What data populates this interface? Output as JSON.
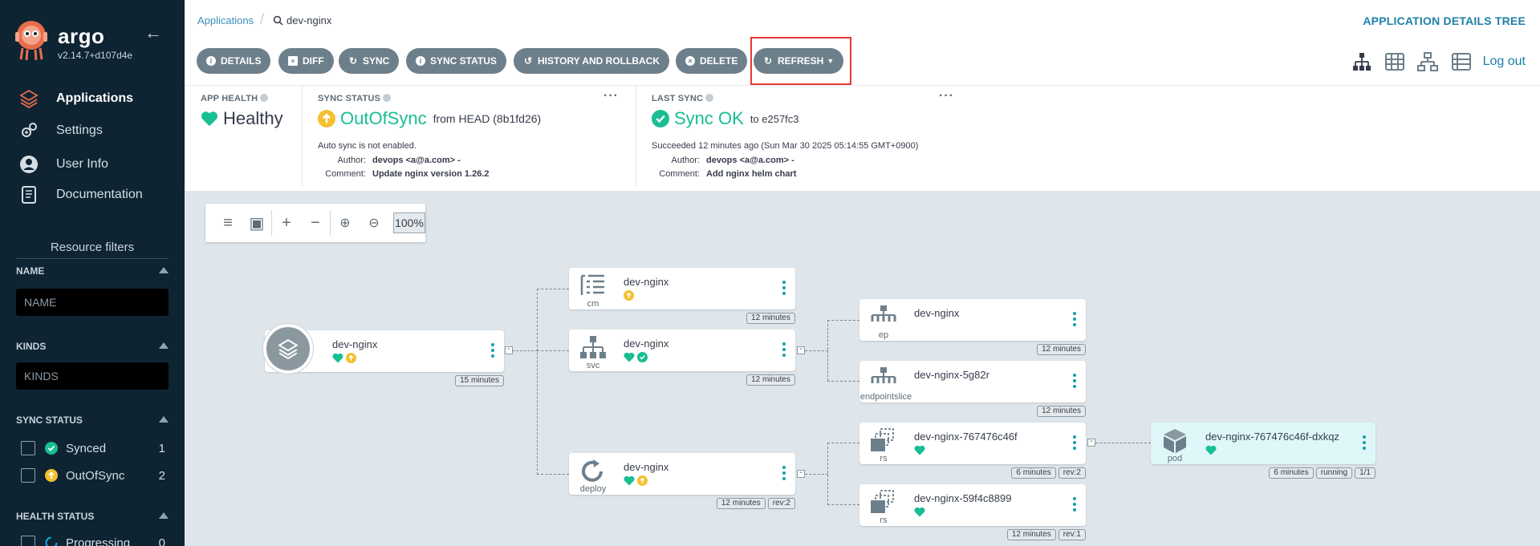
{
  "sidebar": {
    "brand": "argo",
    "version": "v2.14.7+d107d4e",
    "nav": [
      {
        "label": "Applications"
      },
      {
        "label": "Settings"
      },
      {
        "label": "User Info"
      },
      {
        "label": "Documentation"
      }
    ],
    "resource_filters": {
      "title": "Resource filters",
      "name_label": "NAME",
      "name_placeholder": "NAME",
      "kinds_label": "KINDS",
      "kinds_placeholder": "KINDS",
      "sync_label": "SYNC STATUS",
      "sync_items": [
        {
          "label": "Synced",
          "count": "1"
        },
        {
          "label": "OutOfSync",
          "count": "2"
        }
      ],
      "health_label": "HEALTH STATUS",
      "health_items": [
        {
          "label": "Progressing",
          "count": "0"
        }
      ]
    }
  },
  "topbar": {
    "crumb_app": "Applications",
    "crumb_current": "dev-nginx",
    "page_title": "APPLICATION DETAILS TREE"
  },
  "toolbar": {
    "buttons": [
      {
        "label": "DETAILS"
      },
      {
        "label": "DIFF"
      },
      {
        "label": "SYNC"
      },
      {
        "label": "SYNC STATUS"
      },
      {
        "label": "HISTORY AND ROLLBACK"
      },
      {
        "label": "DELETE"
      },
      {
        "label": "REFRESH"
      }
    ],
    "logout": "Log out"
  },
  "status": {
    "app_health": {
      "label": "APP HEALTH",
      "value": "Healthy"
    },
    "sync_status": {
      "label": "SYNC STATUS",
      "value": "OutOfSync",
      "from": "from HEAD (8b1fd26)",
      "auto_sync": "Auto sync is not enabled.",
      "author_key": "Author:",
      "author": "devops <a@a.com> -",
      "comment_key": "Comment:",
      "comment": "Update nginx version 1.26.2"
    },
    "last_sync": {
      "label": "LAST SYNC",
      "value": "Sync OK",
      "to": "to e257fc3",
      "succeeded": "Succeeded 12 minutes ago (Sun Mar 30 2025 05:14:55 GMT+0900)",
      "author_key": "Author:",
      "author": "devops <a@a.com> -",
      "comment_key": "Comment:",
      "comment": "Add nginx helm chart"
    }
  },
  "zoom": {
    "percent": "100%"
  },
  "tree": {
    "app": {
      "name": "dev-nginx",
      "age": "15 minutes"
    },
    "nodes": [
      {
        "id": "cm",
        "name": "dev-nginx",
        "kind": "cm",
        "tags": [
          "12 minutes"
        ]
      },
      {
        "id": "svc",
        "name": "dev-nginx",
        "kind": "svc",
        "tags": [
          "12 minutes"
        ]
      },
      {
        "id": "deploy",
        "name": "dev-nginx",
        "kind": "deploy",
        "tags": [
          "12 minutes",
          "rev:2"
        ]
      },
      {
        "id": "ep",
        "name": "dev-nginx",
        "kind": "ep",
        "tags": [
          "12 minutes"
        ]
      },
      {
        "id": "eps",
        "name": "dev-nginx-5g82r",
        "kind": "endpointslice",
        "tags": [
          "12 minutes"
        ]
      },
      {
        "id": "rs1",
        "name": "dev-nginx-767476c46f",
        "kind": "rs",
        "tags": [
          "6 minutes",
          "rev:2"
        ]
      },
      {
        "id": "rs2",
        "name": "dev-nginx-59f4c8899",
        "kind": "rs",
        "tags": [
          "12 minutes",
          "rev:1"
        ]
      },
      {
        "id": "pod",
        "name": "dev-nginx-767476c46f-dxkqz",
        "kind": "pod",
        "tags": [
          "6 minutes",
          "running",
          "1/1"
        ]
      }
    ]
  },
  "colors": {
    "sidebar_bg": "#0e2433",
    "accent": "#1d7fa8",
    "healthy": "#18be94",
    "outofsync": "#f4c030",
    "button_bg": "#6d7f8b",
    "highlight": "#e53935"
  }
}
